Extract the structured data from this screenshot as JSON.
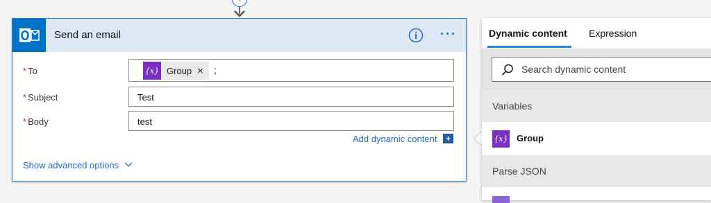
{
  "connector": {
    "add_label": "+"
  },
  "action": {
    "title": "Send an email",
    "fields": {
      "to": {
        "label": "To",
        "token": {
          "icon": "{x}",
          "label": "Group",
          "remove": "×"
        },
        "separator": ";"
      },
      "subject": {
        "label": "Subject",
        "value": "Test"
      },
      "body": {
        "label": "Body",
        "value": "test"
      }
    },
    "required_marker": "*",
    "add_dynamic_label": "Add dynamic content",
    "add_dynamic_icon": "+",
    "show_advanced_label": "Show advanced options",
    "more_label": "···"
  },
  "panel": {
    "tabs": [
      {
        "label": "Dynamic content"
      },
      {
        "label": "Expression"
      }
    ],
    "search": {
      "placeholder": "Search dynamic content",
      "value": ""
    },
    "sections": [
      {
        "label": "Variables",
        "items": [
          {
            "icon": "{x}",
            "label": "Group"
          }
        ]
      },
      {
        "label": "Parse JSON",
        "items": []
      }
    ]
  },
  "colors": {
    "accent": "#2b7fd4",
    "outlook": "#0072c6",
    "variable": "#7a2fc2",
    "header_bg": "#dde8f4"
  }
}
